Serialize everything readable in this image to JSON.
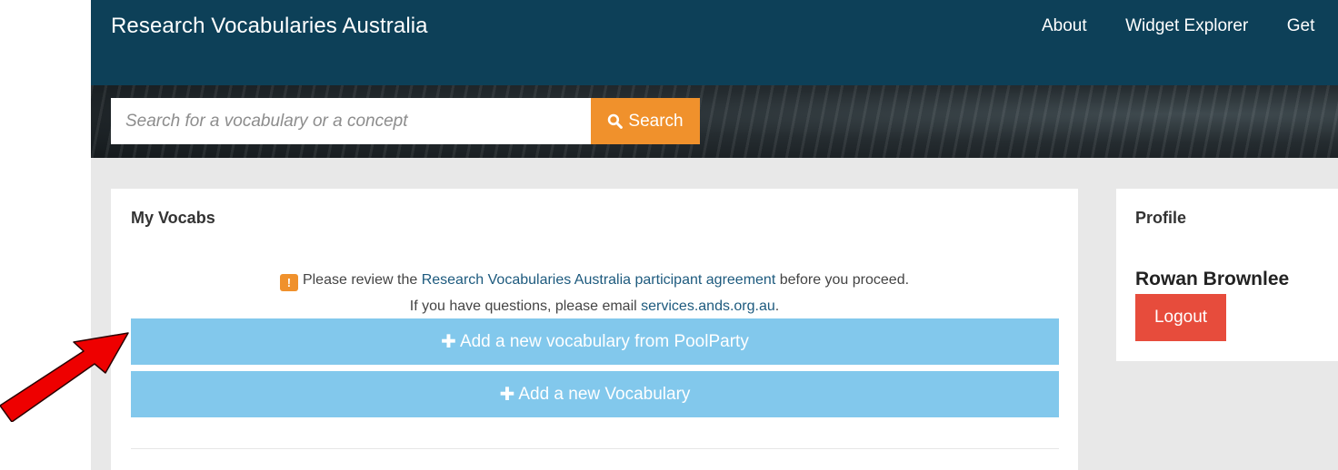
{
  "header": {
    "brand": "Research Vocabularies Australia",
    "nav": [
      "About",
      "Widget Explorer",
      "Get"
    ]
  },
  "search": {
    "placeholder": "Search for a vocabulary or a concept",
    "button_label": "Search",
    "button_icon": "search-icon"
  },
  "my_vocabs": {
    "title": "My Vocabs",
    "notice_icon": "warning-icon",
    "notice_icon_text": "!",
    "notice_before": "Please review the",
    "notice_link": "Research Vocabularies Australia participant agreement",
    "notice_after": "before you proceed.",
    "questions_before": "If you have questions, please email",
    "questions_link": "services.ands.org.au",
    "questions_after": ".",
    "add_poolparty_label": "Add a new vocabulary from PoolParty",
    "add_vocabulary_label": "Add a new Vocabulary",
    "plus_icon": "plus-icon"
  },
  "profile": {
    "title": "Profile",
    "name": "Rowan Brownlee",
    "logout_label": "Logout"
  },
  "annotation": {
    "arrow_icon": "red-arrow-icon"
  },
  "colors": {
    "navbar": "#0d4058",
    "search_button": "#f0912c",
    "add_button": "#82c8ec",
    "logout_button": "#e74c3c",
    "link": "#1d5a7e",
    "annotation_arrow": "#ee0000"
  }
}
